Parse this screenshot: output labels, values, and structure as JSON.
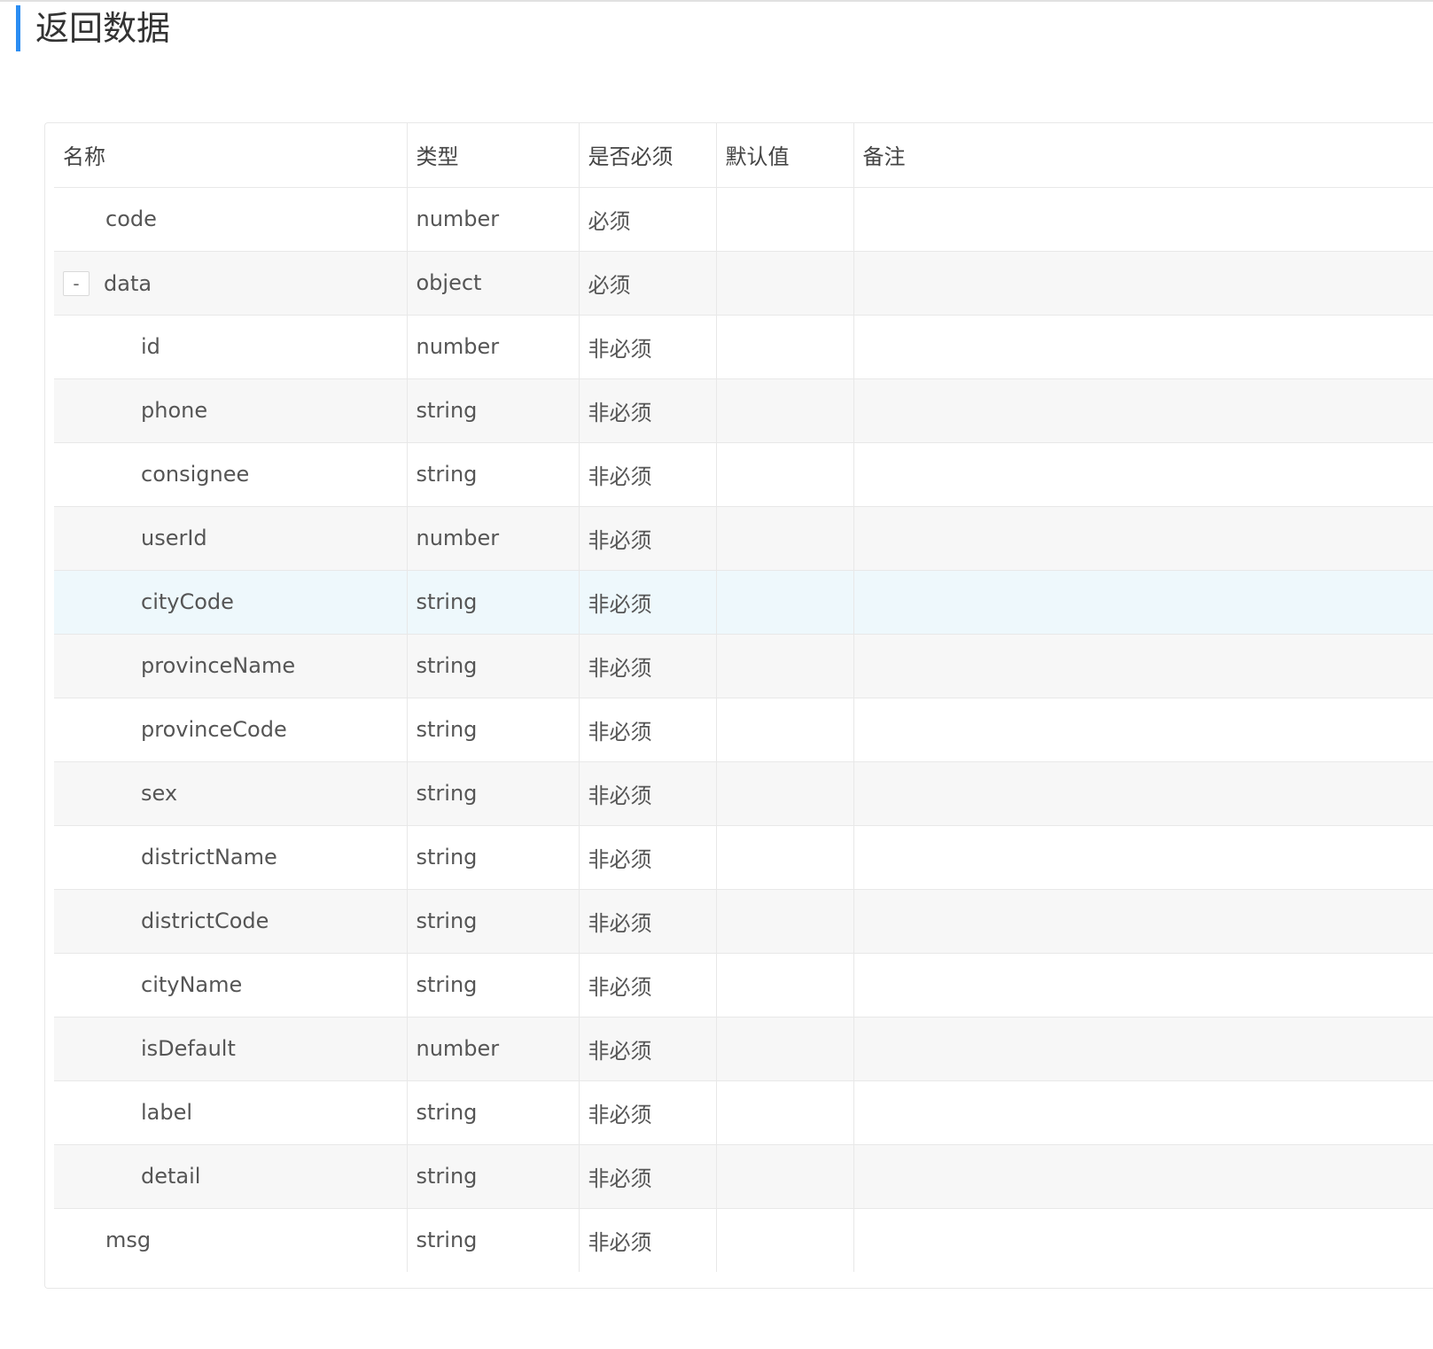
{
  "section": {
    "title": "返回数据"
  },
  "table": {
    "headers": {
      "name": "名称",
      "type": "类型",
      "required": "是否必须",
      "default": "默认值",
      "remark": "备注"
    },
    "expand_toggle": "-",
    "rows": [
      {
        "name": "code",
        "type": "number",
        "required": "必须",
        "default": "",
        "remark": "",
        "level": 0
      },
      {
        "name": "data",
        "type": "object",
        "required": "必须",
        "default": "",
        "remark": "",
        "level": 0,
        "expandable": true
      },
      {
        "name": "id",
        "type": "number",
        "required": "非必须",
        "default": "",
        "remark": "",
        "level": 1
      },
      {
        "name": "phone",
        "type": "string",
        "required": "非必须",
        "default": "",
        "remark": "",
        "level": 1
      },
      {
        "name": "consignee",
        "type": "string",
        "required": "非必须",
        "default": "",
        "remark": "",
        "level": 1
      },
      {
        "name": "userId",
        "type": "number",
        "required": "非必须",
        "default": "",
        "remark": "",
        "level": 1
      },
      {
        "name": "cityCode",
        "type": "string",
        "required": "非必须",
        "default": "",
        "remark": "",
        "level": 1
      },
      {
        "name": "provinceName",
        "type": "string",
        "required": "非必须",
        "default": "",
        "remark": "",
        "level": 1
      },
      {
        "name": "provinceCode",
        "type": "string",
        "required": "非必须",
        "default": "",
        "remark": "",
        "level": 1
      },
      {
        "name": "sex",
        "type": "string",
        "required": "非必须",
        "default": "",
        "remark": "",
        "level": 1
      },
      {
        "name": "districtName",
        "type": "string",
        "required": "非必须",
        "default": "",
        "remark": "",
        "level": 1
      },
      {
        "name": "districtCode",
        "type": "string",
        "required": "非必须",
        "default": "",
        "remark": "",
        "level": 1
      },
      {
        "name": "cityName",
        "type": "string",
        "required": "非必须",
        "default": "",
        "remark": "",
        "level": 1
      },
      {
        "name": "isDefault",
        "type": "number",
        "required": "非必须",
        "default": "",
        "remark": "",
        "level": 1
      },
      {
        "name": "label",
        "type": "string",
        "required": "非必须",
        "default": "",
        "remark": "",
        "level": 1
      },
      {
        "name": "detail",
        "type": "string",
        "required": "非必须",
        "default": "",
        "remark": "",
        "level": 1
      },
      {
        "name": "msg",
        "type": "string",
        "required": "非必须",
        "default": "",
        "remark": "",
        "level": 0
      }
    ]
  },
  "colors": {
    "accent": "#2b8df2",
    "row_alt": "#f7f7f7",
    "row_hover": "#eef8fc",
    "border": "#e8e8e8"
  }
}
